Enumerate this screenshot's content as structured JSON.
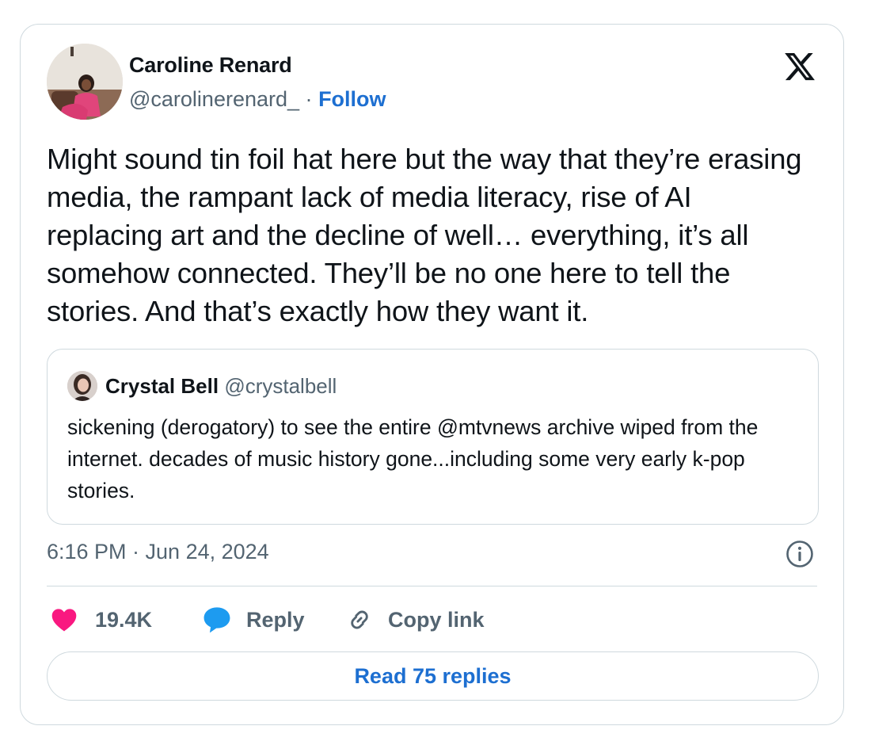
{
  "tweet": {
    "author": {
      "display_name": "Caroline Renard",
      "handle": "@carolinerenard_",
      "separator": "·",
      "follow_label": "Follow"
    },
    "text": "Might sound tin foil hat here but the way that they’re erasing media, the rampant lack of media literacy, rise of AI replacing art and the decline of well… everything, it’s all somehow connected. They’ll be no one here to tell the stories. And that’s exactly how they want it.",
    "quoted_tweet": {
      "display_name": "Crystal Bell",
      "handle": "@crystalbell",
      "text": "sickening (derogatory) to see the entire @mtvnews archive wiped from the internet. decades of music history gone...including some very early k-pop stories."
    },
    "timestamp": "6:16 PM · Jun 24, 2024",
    "actions": {
      "like_count": "19.4K",
      "reply_label": "Reply",
      "copy_link_label": "Copy link"
    },
    "read_replies_label": "Read 75 replies"
  },
  "icons": {
    "brand": "x-logo-icon",
    "info": "info-icon",
    "like": "heart-icon",
    "reply": "speech-bubble-icon",
    "copy": "link-icon"
  },
  "colors": {
    "link_blue": "#1d6fd1",
    "like_pink": "#f91880",
    "reply_blue": "#1d9bf0",
    "secondary_text": "#536471",
    "border": "#cfd9de"
  }
}
